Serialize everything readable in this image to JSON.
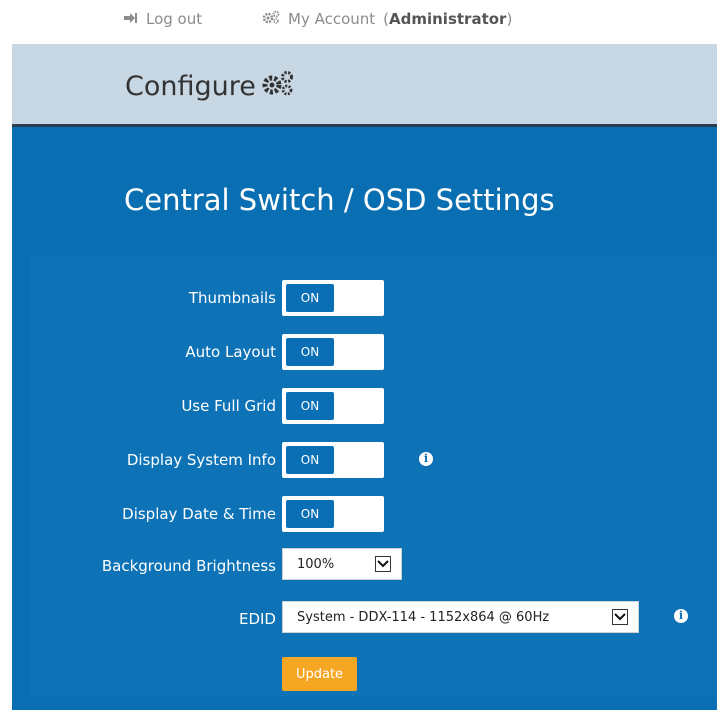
{
  "topbar": {
    "logout_label": "Log out",
    "account_label": "My Account",
    "role": "Administrator"
  },
  "header": {
    "title": "Configure"
  },
  "panel": {
    "title": "Central Switch / OSD Settings",
    "settings": [
      {
        "label": "Thumbnails",
        "state": "ON"
      },
      {
        "label": "Auto Layout",
        "state": "ON"
      },
      {
        "label": "Use Full Grid",
        "state": "ON"
      },
      {
        "label": "Display System Info",
        "state": "ON"
      },
      {
        "label": "Display Date & Time",
        "state": "ON"
      }
    ],
    "brightness": {
      "label": "Background Brightness",
      "value": "100%"
    },
    "edid": {
      "label": "EDID",
      "value": "System - DDX-114 - 1152x864 @ 60Hz"
    },
    "update_label": "Update"
  },
  "colors": {
    "panel_blue": "#0a6fb2",
    "header_band": "#c8d7e4",
    "update_orange": "#f5a623"
  }
}
